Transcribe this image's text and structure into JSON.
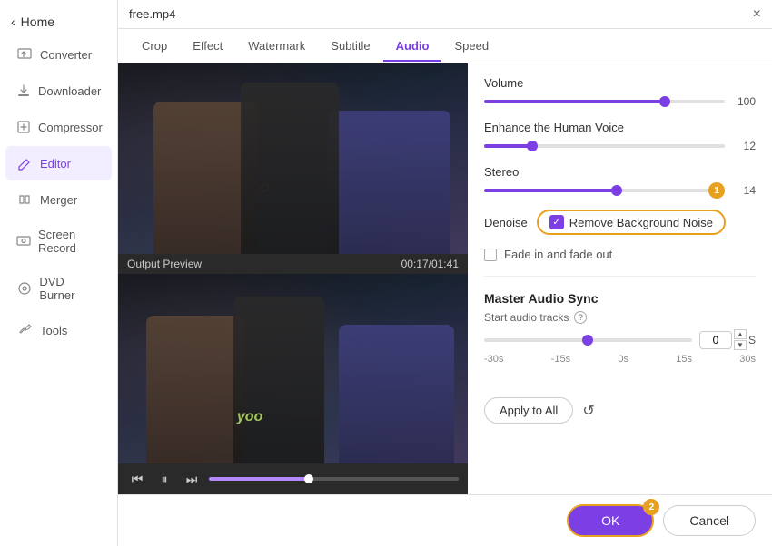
{
  "titlebar": {
    "title": "free.mp4",
    "close": "×"
  },
  "tabs": [
    {
      "id": "crop",
      "label": "Crop"
    },
    {
      "id": "effect",
      "label": "Effect"
    },
    {
      "id": "watermark",
      "label": "Watermark"
    },
    {
      "id": "subtitle",
      "label": "Subtitle"
    },
    {
      "id": "audio",
      "label": "Audio",
      "active": true
    },
    {
      "id": "speed",
      "label": "Speed"
    }
  ],
  "sidebar": {
    "home_label": "Home",
    "items": [
      {
        "id": "converter",
        "label": "Converter",
        "icon": "⬇"
      },
      {
        "id": "downloader",
        "label": "Downloader",
        "icon": "⬇"
      },
      {
        "id": "compressor",
        "label": "Compressor",
        "icon": "⬛"
      },
      {
        "id": "editor",
        "label": "Editor",
        "icon": "✂",
        "active": true
      },
      {
        "id": "merger",
        "label": "Merger",
        "icon": "⬛"
      },
      {
        "id": "screen_record",
        "label": "Screen Record",
        "icon": "⬛"
      },
      {
        "id": "dvd_burner",
        "label": "DVD Burner",
        "icon": "⬛"
      },
      {
        "id": "tools",
        "label": "Tools",
        "icon": "⬛"
      }
    ]
  },
  "video": {
    "preview_label": "Output Preview",
    "timestamp": "00:17/01:41",
    "watermark": "yoo"
  },
  "audio_panel": {
    "volume_label": "Volume",
    "volume_value": "100",
    "volume_pct": 75,
    "enhance_label": "Enhance the Human Voice",
    "enhance_value": "12",
    "enhance_pct": 20,
    "stereo_label": "Stereo",
    "stereo_value": "14",
    "stereo_pct": 55,
    "stereo_badge": "1",
    "denoise_label": "Denoise",
    "denoise_checkbox_label": "Remove Background Noise",
    "fade_label": "Fade in and fade out",
    "master_title": "Master Audio Sync",
    "master_subtitle": "Start audio tracks",
    "sync_labels": [
      "-30s",
      "-15s",
      "0s",
      "15s",
      "30s"
    ],
    "sync_value": "0",
    "sync_unit": "S",
    "apply_label": "Apply to All",
    "ok_label": "OK",
    "ok_badge": "2",
    "cancel_label": "Cancel"
  }
}
